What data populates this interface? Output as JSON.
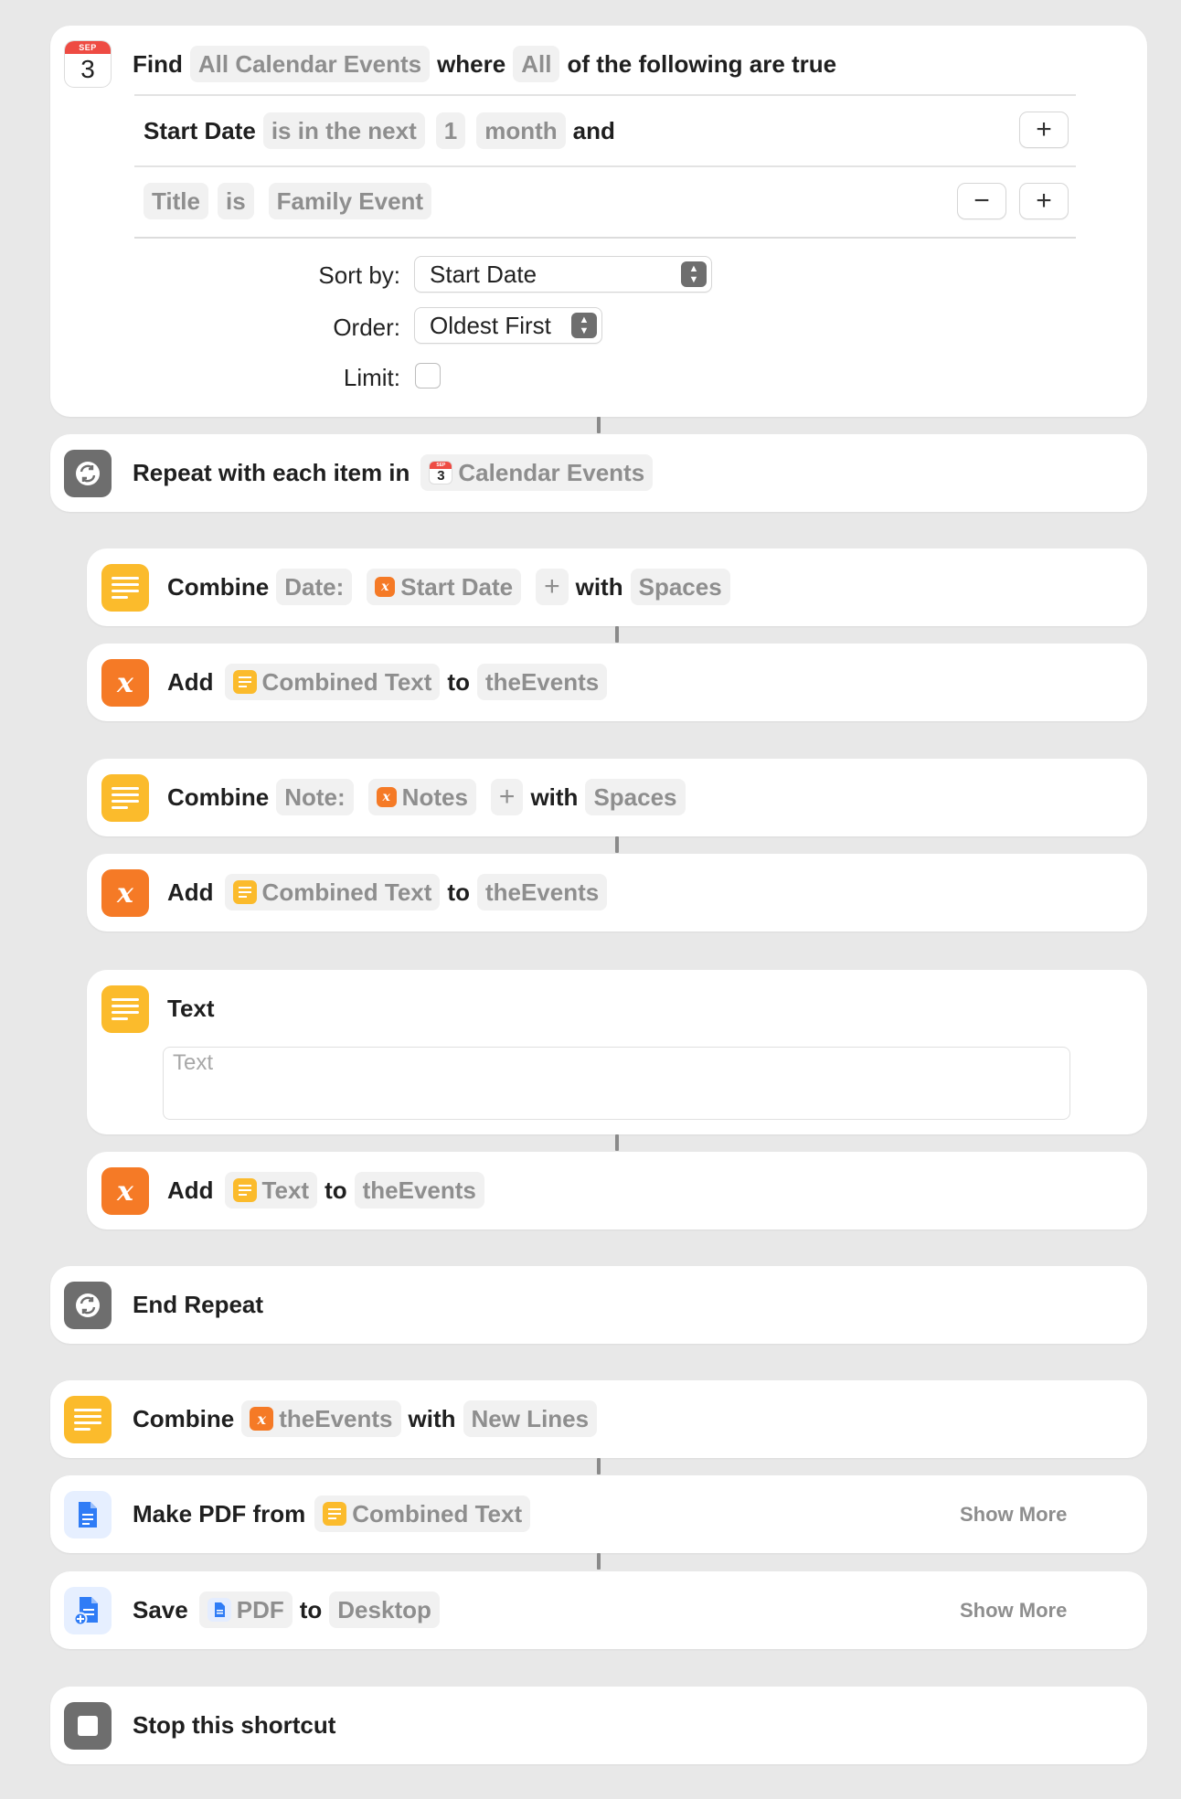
{
  "find_block": {
    "month": "SEP",
    "day": "3",
    "find": "Find",
    "source": "All Calendar Events",
    "where": "where",
    "match": "All",
    "of_following": "of the following are true",
    "filter1": {
      "field": "Start Date",
      "op": "is in the next",
      "count": "1",
      "unit": "month",
      "joiner": "and",
      "add": "+"
    },
    "filter2": {
      "field": "Title",
      "op": "is",
      "value": "Family Event",
      "remove": "−",
      "add": "+"
    },
    "sort_label": "Sort by:",
    "sort_value": "Start Date",
    "order_label": "Order:",
    "order_value": "Oldest First",
    "limit_label": "Limit:"
  },
  "repeat": {
    "label": "Repeat with each item in",
    "var": "Calendar Events",
    "month": "SEP",
    "day": "3"
  },
  "combine1": {
    "verb": "Combine",
    "prefix": "Date:",
    "var": "Start Date",
    "plus": "+",
    "with": "with",
    "sep": "Spaces"
  },
  "add1": {
    "verb": "Add",
    "var": "Combined Text",
    "to": "to",
    "target": "theEvents"
  },
  "combine2": {
    "verb": "Combine",
    "prefix": "Note:",
    "var": "Notes",
    "plus": "+",
    "with": "with",
    "sep": "Spaces"
  },
  "add2": {
    "verb": "Add",
    "var": "Combined Text",
    "to": "to",
    "target": "theEvents"
  },
  "text_action": {
    "title": "Text",
    "placeholder": "Text"
  },
  "add3": {
    "verb": "Add",
    "var": "Text",
    "to": "to",
    "target": "theEvents"
  },
  "end_repeat": {
    "label": "End Repeat"
  },
  "combine3": {
    "verb": "Combine",
    "var": "theEvents",
    "with": "with",
    "sep": "New Lines"
  },
  "make_pdf": {
    "label": "Make PDF from",
    "var": "Combined Text",
    "show_more": "Show More"
  },
  "save": {
    "verb": "Save",
    "var": "PDF",
    "to": "to",
    "dest": "Desktop",
    "show_more": "Show More"
  },
  "stop": {
    "label": "Stop this shortcut"
  },
  "colors": {
    "background": "#e8e8e8",
    "card": "#ffffff",
    "yellow": "#fbbb2c",
    "orange": "#f57a26",
    "gray": "#6e6e6e",
    "blue": "#2f7cf6",
    "red": "#ee4b43"
  }
}
